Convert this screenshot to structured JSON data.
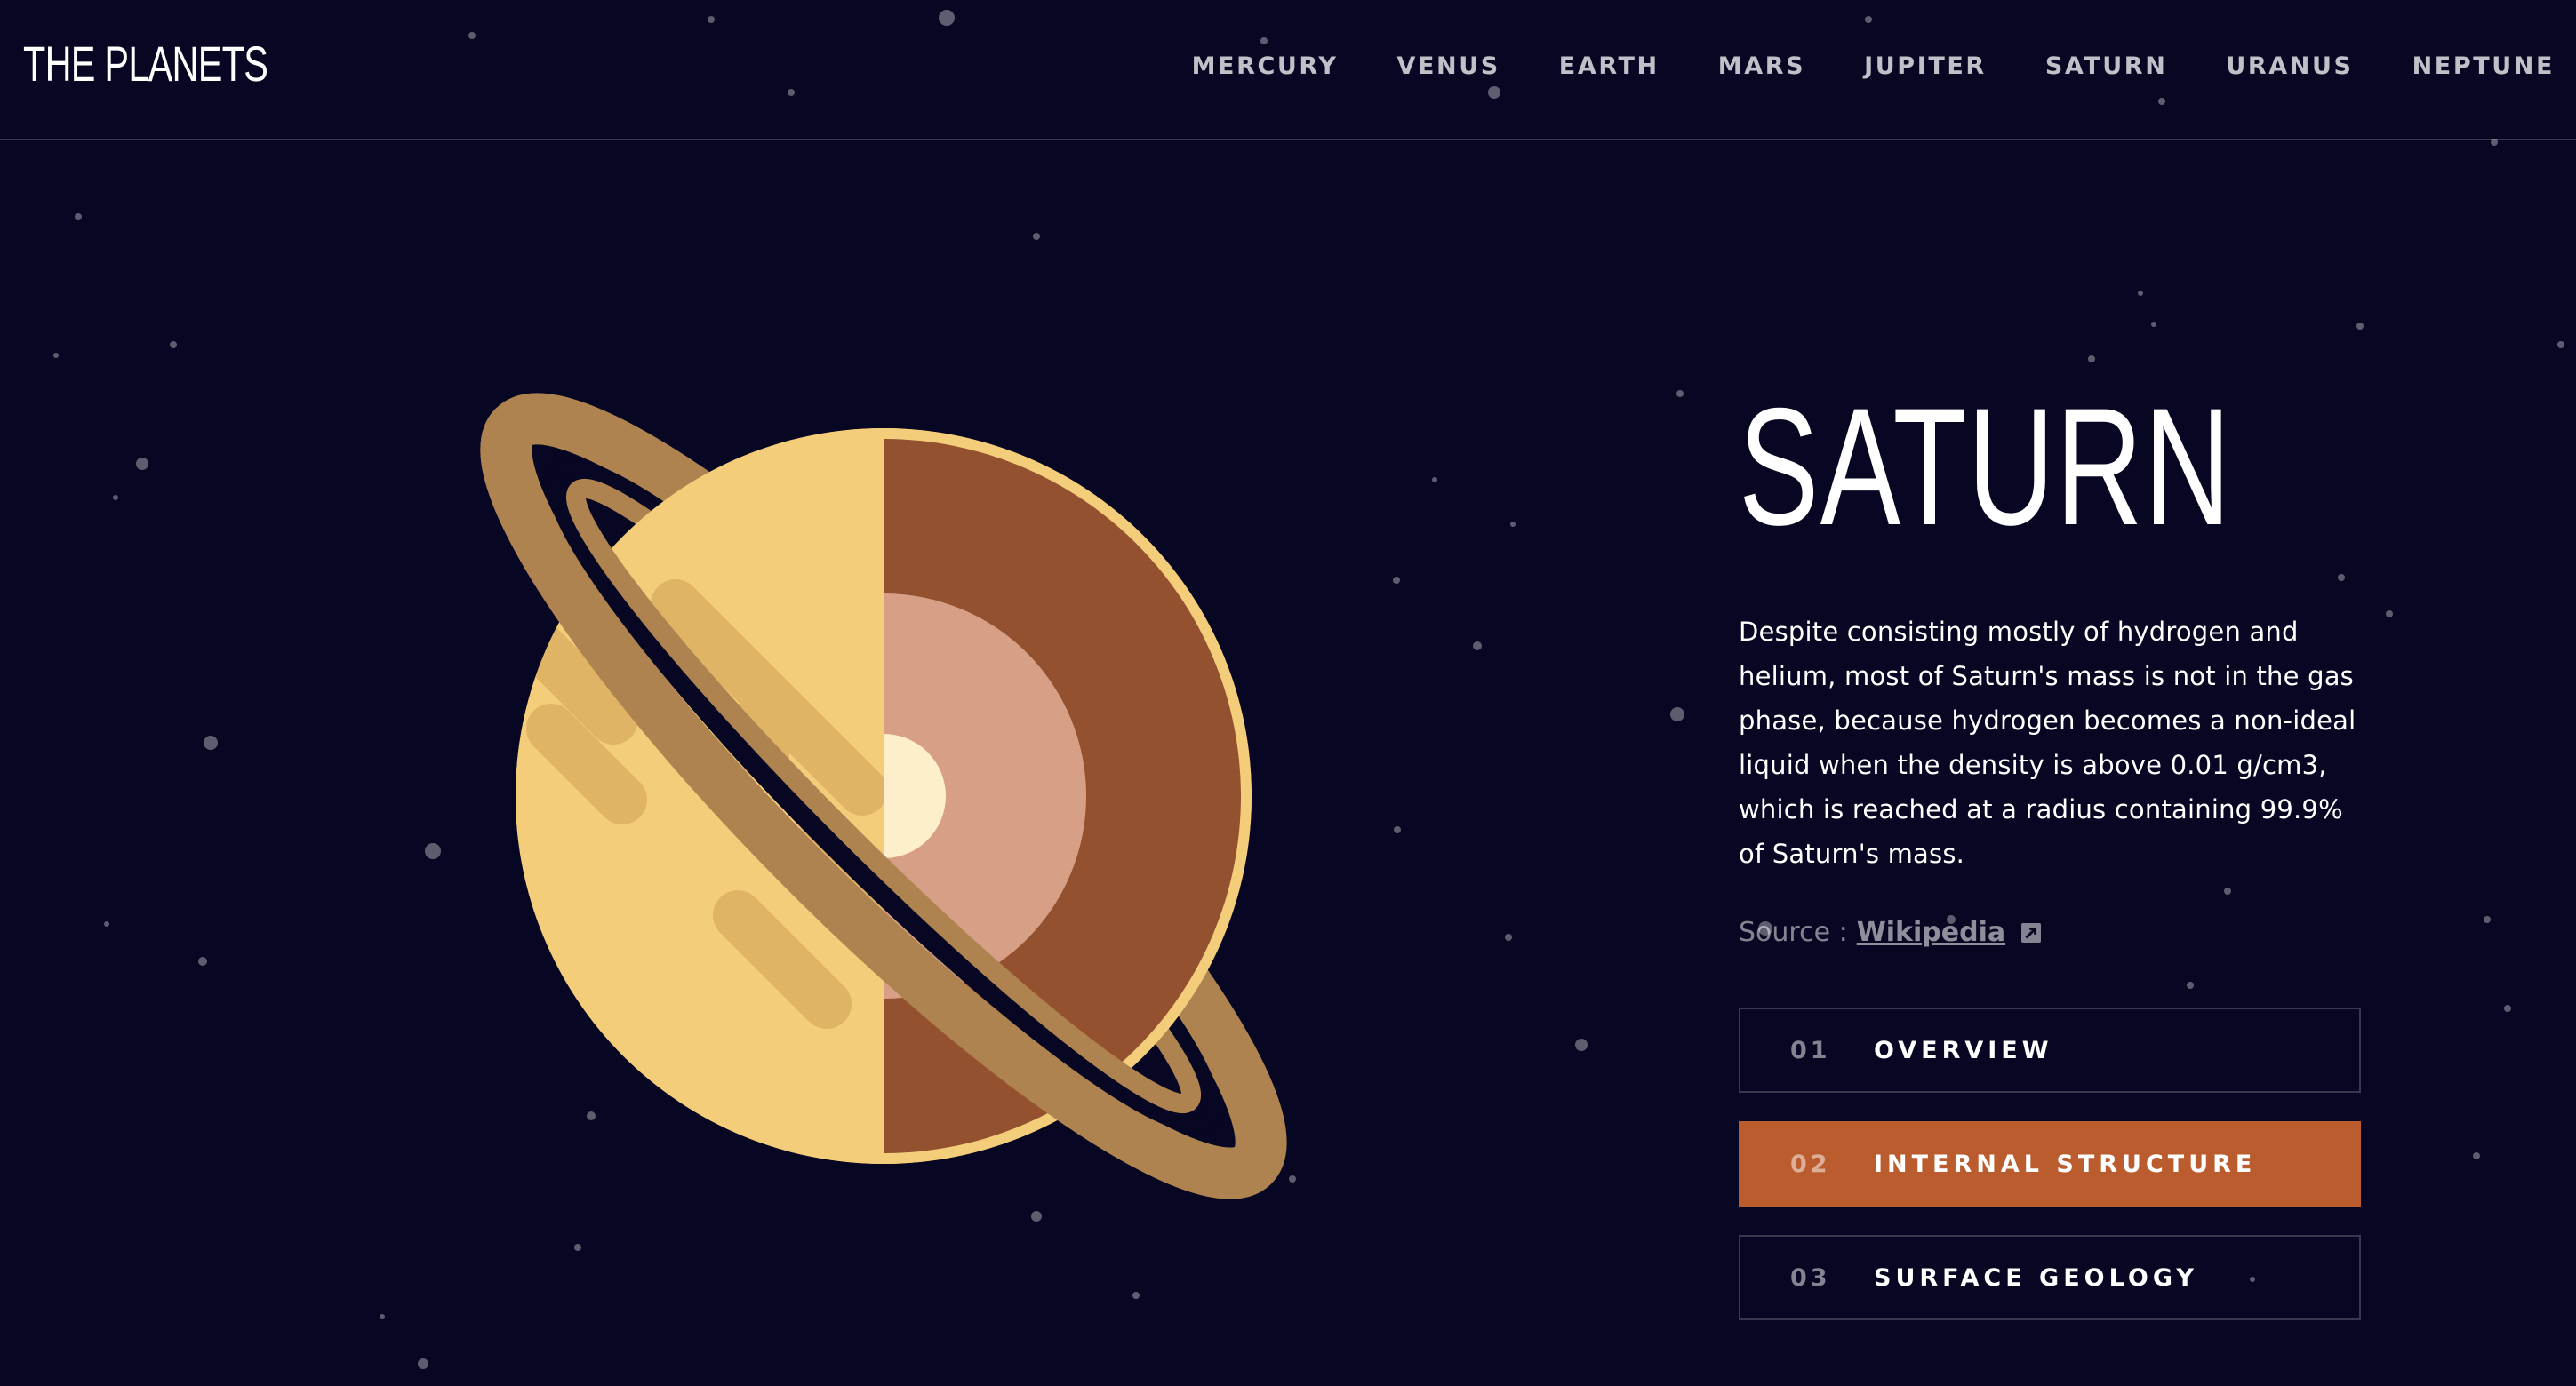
{
  "app": {
    "logo": "THE PLANETS"
  },
  "nav": {
    "items": [
      "MERCURY",
      "VENUS",
      "EARTH",
      "MARS",
      "JUPITER",
      "SATURN",
      "URANUS",
      "NEPTUNE"
    ]
  },
  "planet": {
    "name": "SATURN",
    "description": "Despite consisting mostly of hydrogen and helium, most of Saturn's mass is not in the gas phase, because hydrogen becomes a non-ideal liquid when the density is above 0.01 g/cm3, which is reached at a radius containing 99.9% of Saturn's mass.",
    "source_label": "Source :",
    "source_link": "Wikipedia",
    "source_icon": "external-link-icon"
  },
  "tabs": [
    {
      "num": "01",
      "label": "OVERVIEW",
      "active": false
    },
    {
      "num": "02",
      "label": "INTERNAL STRUCTURE",
      "active": true
    },
    {
      "num": "03",
      "label": "SURFACE GEOLOGY",
      "active": false
    }
  ],
  "colors": {
    "background": "#070724",
    "accent_saturn": "#BA5C2E",
    "planet_surface": "#F4CD7A",
    "ring": "#AF8350",
    "mantle": "#935130",
    "core_outer": "#D7A086",
    "core_inner": "#FDEECC"
  }
}
